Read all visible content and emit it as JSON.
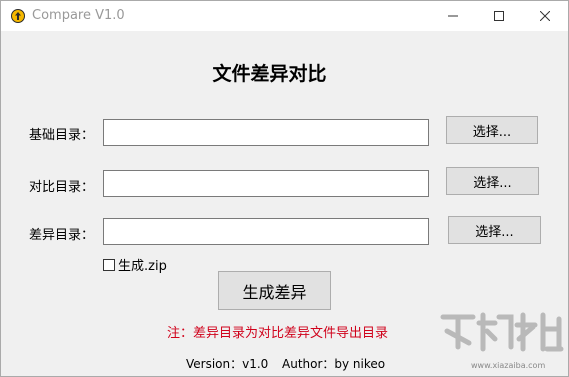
{
  "window": {
    "title": "Compare V1.0",
    "controls": [
      "minimize-icon",
      "maximize-icon",
      "close-icon"
    ]
  },
  "heading": "文件差异对比",
  "rows": [
    {
      "label": "基础目录：",
      "value": "",
      "button": "选择..."
    },
    {
      "label": "对比目录：",
      "value": "",
      "button": "选择..."
    },
    {
      "label": "差异目录：",
      "value": "",
      "button": "选择..."
    }
  ],
  "zip_option": {
    "label": "生成.zip",
    "checked": false
  },
  "generate_button": "生成差异",
  "note": "注：差异目录为对比差异文件导出目录",
  "footer": {
    "version": "Version：v1.0",
    "author": "Author：by nikeo"
  },
  "watermark": {
    "url": "www.xiazaiba.com"
  },
  "colors": {
    "note_text": "#d0021b",
    "app_icon": "#f5b800",
    "button_face": "#e1e1e1"
  }
}
